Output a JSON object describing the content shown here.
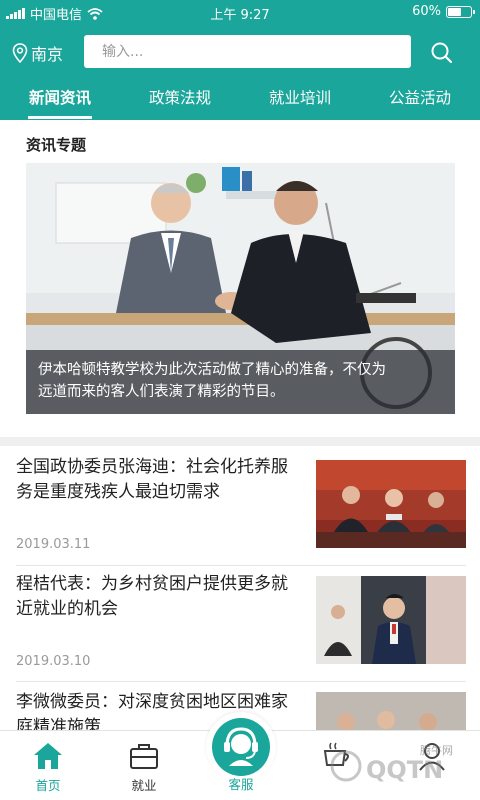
{
  "status_bar": {
    "carrier": "中国电信",
    "time": "上午 9:27",
    "battery_percent": "60%",
    "battery_level": 0.6
  },
  "header": {
    "location": "南京",
    "search_placeholder": "输入...",
    "tabs": [
      {
        "label": "新闻资讯",
        "active": true
      },
      {
        "label": "政策法规",
        "active": false
      },
      {
        "label": "就业培训",
        "active": false
      },
      {
        "label": "公益活动",
        "active": false
      }
    ]
  },
  "feature": {
    "section_title": "资讯专题",
    "caption_line1": "伊本哈顿特教学校为此次活动做了精心的准备，不仅为",
    "caption_line2": "远道而来的客人们表演了精彩的节目。"
  },
  "news": [
    {
      "title": "全国政协委员张海迪：社会化托养服务是重度残疾人最迫切需求",
      "date": "2019.03.11"
    },
    {
      "title": "程桔代表：为乡村贫困户提供更多就近就业的机会",
      "date": "2019.03.10"
    },
    {
      "title": "李微微委员：对深度贫困地区困难家庭精准施策",
      "date": ""
    }
  ],
  "bottom_nav": {
    "items": [
      {
        "label": "首页",
        "icon": "home-icon",
        "active": true
      },
      {
        "label": "就业",
        "icon": "briefcase-icon",
        "active": false
      },
      {
        "label": "客服",
        "icon": "customer-service-icon",
        "active": false
      },
      {
        "label": "",
        "icon": "coffee-icon",
        "active": false
      },
      {
        "label": "",
        "icon": "user-icon",
        "active": false
      }
    ]
  },
  "watermark": "腾牛网",
  "colors": {
    "primary": "#1aa69a",
    "divider": "#efefef",
    "text": "#222222",
    "muted": "#9a9a9a"
  }
}
